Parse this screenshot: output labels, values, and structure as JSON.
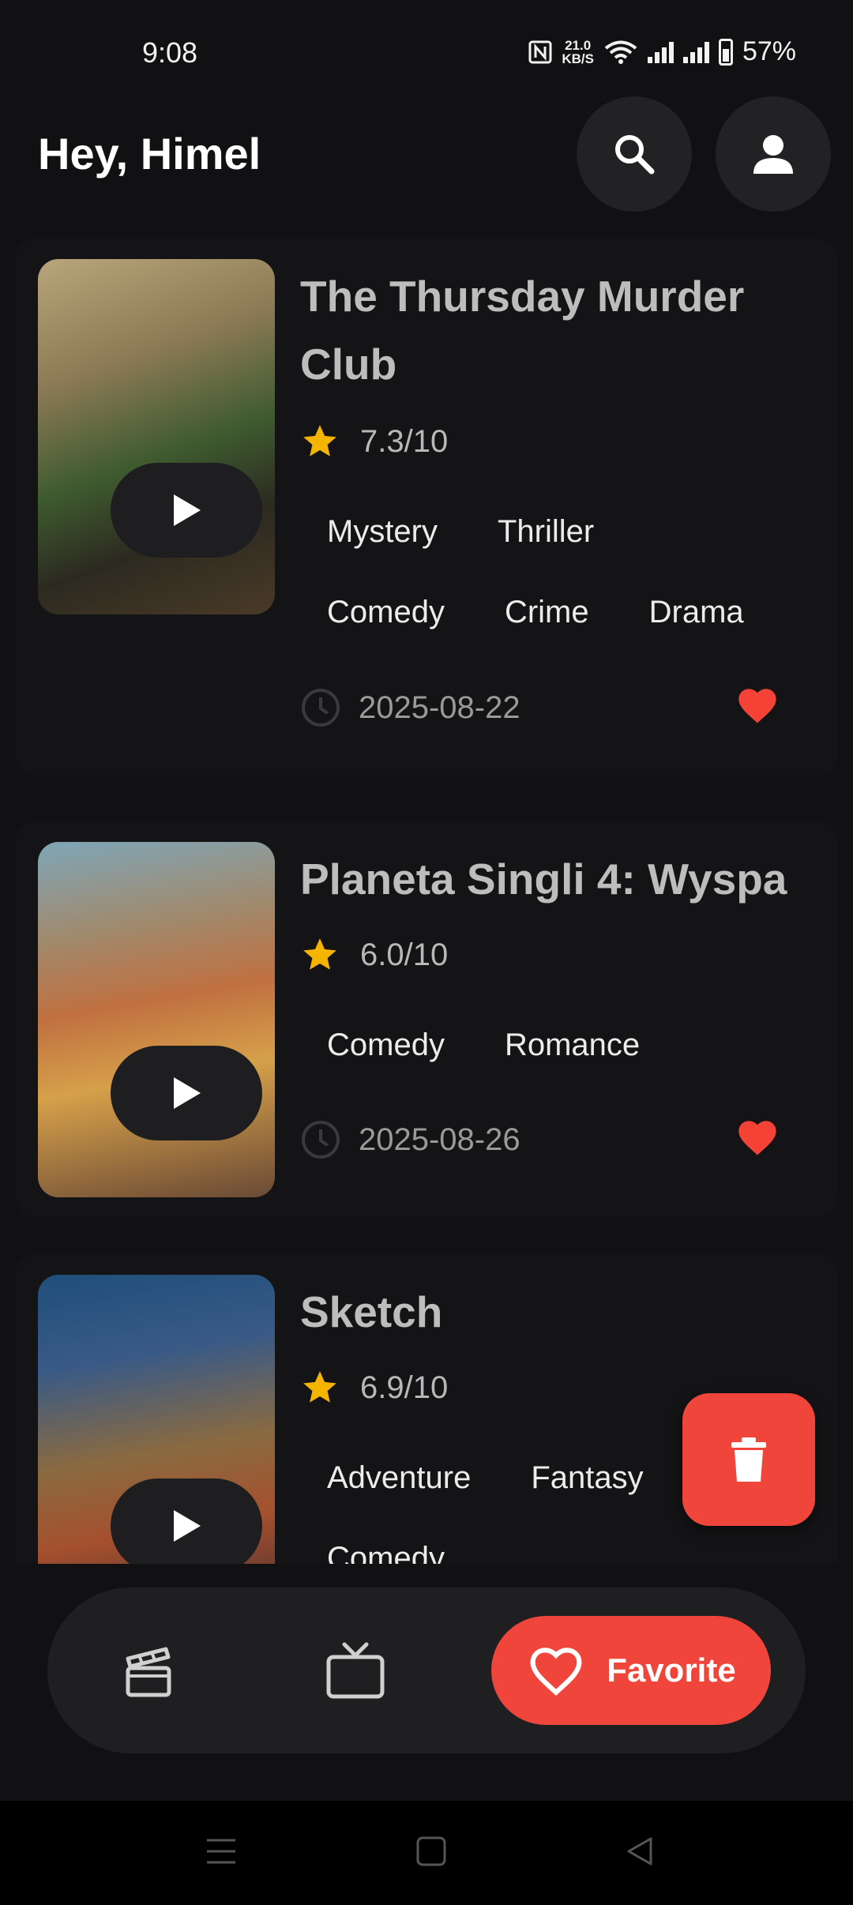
{
  "status": {
    "time": "9:08",
    "net_speed_value": "21.0",
    "net_speed_unit": "KB/S",
    "battery": "57%"
  },
  "header": {
    "greeting": "Hey, Himel"
  },
  "movies": [
    {
      "title": "The Thursday Murder Club",
      "rating": "7.3/10",
      "genres": [
        "Mystery",
        "Thriller",
        "Comedy",
        "Crime",
        "Drama"
      ],
      "date": "2025-08-22",
      "favorite": true
    },
    {
      "title": "Planeta Singli 4: Wyspa",
      "rating": "6.0/10",
      "genres": [
        "Comedy",
        "Romance"
      ],
      "date": "2025-08-26",
      "favorite": true
    },
    {
      "title": "Sketch",
      "rating": "6.9/10",
      "genres": [
        "Adventure",
        "Fantasy",
        "Comedy"
      ]
    }
  ],
  "nav": {
    "favorite_label": "Favorite",
    "active": "favorite"
  },
  "colors": {
    "accent": "#f0453a",
    "star": "#f5b400",
    "background": "#111113",
    "heart": "#f44336"
  },
  "icons": [
    "search-icon",
    "person-icon",
    "play-icon",
    "star-icon",
    "clock-icon",
    "heart-icon",
    "trash-icon",
    "movie-clapper-icon",
    "tv-icon",
    "heart-outline-icon"
  ]
}
